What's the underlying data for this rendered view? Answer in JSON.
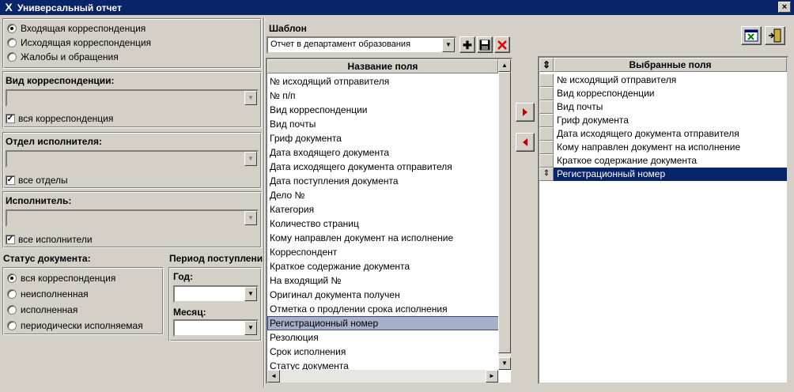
{
  "window": {
    "title": "Универсальный отчет",
    "close_glyph": "×"
  },
  "direction": {
    "options": [
      "Входящая корреспонденция",
      "Исходящая корреспонденция",
      "Жалобы и обращения"
    ],
    "selected": 0
  },
  "corr_type": {
    "title": "Вид корреспонденции:",
    "value": "",
    "checkbox_label": "вся корреспонденция",
    "checked": true
  },
  "department": {
    "title": "Отдел исполнителя:",
    "value": "",
    "checkbox_label": "все отделы",
    "checked": true
  },
  "executor": {
    "title": "Исполнитель:",
    "value": "",
    "checkbox_label": "все исполнители",
    "checked": true
  },
  "status": {
    "title": "Статус документа:",
    "options": [
      "вся корреспонденция",
      "неисполненная",
      "исполненная",
      "периодически исполняемая"
    ],
    "selected": 0
  },
  "period": {
    "title": "Период поступлени",
    "year_label": "Год:",
    "year_value": "",
    "month_label": "Месяц:",
    "month_value": ""
  },
  "template": {
    "label": "Шаблон",
    "value": "Отчет в департамент образования"
  },
  "fields": {
    "header": "Название поля",
    "items": [
      "№ исходящий отправителя",
      "№ п/п",
      "Вид корреспонденции",
      "Вид почты",
      "Гриф документа",
      "Дата входящего документа",
      "Дата исходящего документа отправителя",
      "Дата поступления документа",
      "Дело №",
      "Категория",
      "Количество страниц",
      "Кому направлен документ на исполнение",
      "Корреспондент",
      "Краткое содержание документа",
      "На входящий №",
      "Оригинал документа получен",
      "Отметка о продлении срока исполнения",
      "Регистрационный номер",
      "Резолюция",
      "Срок исполнения",
      "Статус документа"
    ],
    "selected_index": 17
  },
  "selected_fields": {
    "header": "Выбранные поля",
    "sort_glyph": "⇕",
    "items": [
      "№ исходящий отправителя",
      "Вид корреспонденции",
      "Вид почты",
      "Гриф документа",
      "Дата исходящего документа отправителя",
      "Кому направлен документ на исполнение",
      "Краткое содержание документа",
      "Регистрационный номер"
    ],
    "selected_index": 7
  },
  "icons": {
    "add": "plus-icon",
    "save": "floppy-icon",
    "delete": "red-x-icon",
    "move_right": "arrow-right-icon",
    "move_left": "arrow-left-icon",
    "excel": "excel-export-icon",
    "exit": "exit-door-icon"
  },
  "colors": {
    "title_bar": "#0a246a",
    "selection": "#0a246a",
    "list_highlight": "#a6b0c8",
    "arrow_red": "#c00000",
    "delete_red": "#e00000"
  }
}
